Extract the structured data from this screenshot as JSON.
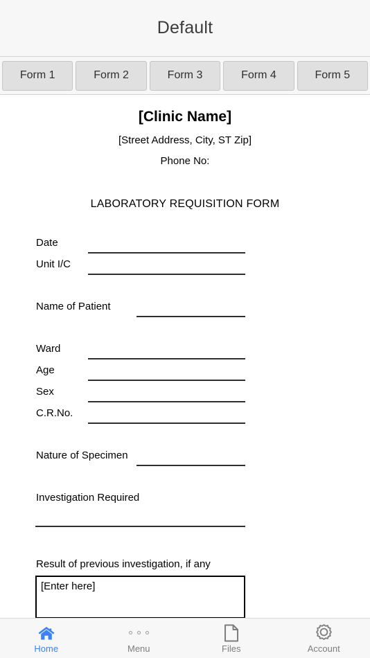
{
  "titlebar": {
    "title": "Default"
  },
  "tabs": [
    {
      "label": "Form 1"
    },
    {
      "label": "Form 2"
    },
    {
      "label": "Form 3"
    },
    {
      "label": "Form 4"
    },
    {
      "label": "Form 5"
    }
  ],
  "form": {
    "clinic_name": "[Clinic Name]",
    "clinic_address": "[Street Address, City, ST Zip]",
    "clinic_phone": "Phone No:",
    "doc_title": "LABORATORY REQUISITION FORM",
    "labels": {
      "date": "Date",
      "unit_ic": "Unit I/C",
      "name_of_patient": "Name of Patient",
      "ward": "Ward",
      "age": "Age",
      "sex": "Sex",
      "cr_no": "C.R.No.",
      "nature_of_specimen": "Nature of Specimen",
      "investigation_required": "Investigation Required",
      "result_previous": "Result of previous investigation, if any"
    },
    "values": {
      "date": "",
      "unit_ic": "",
      "name_of_patient": "",
      "ward": "",
      "age": "",
      "sex": "",
      "cr_no": "",
      "nature_of_specimen": "",
      "investigation_required": "",
      "result_previous": "[Enter here]"
    }
  },
  "bottomnav": {
    "items": [
      {
        "label": "Home",
        "icon": "home-icon",
        "active": true
      },
      {
        "label": "Menu",
        "icon": "dots-icon",
        "active": false
      },
      {
        "label": "Files",
        "icon": "file-icon",
        "active": false
      },
      {
        "label": "Account",
        "icon": "gear-icon",
        "active": false
      }
    ]
  },
  "colors": {
    "accent": "#3b82f6",
    "chrome": "#f7f7f7",
    "tab": "#e0e0e0",
    "rule": "#2e2e2e",
    "muted": "#7d7d7d"
  }
}
